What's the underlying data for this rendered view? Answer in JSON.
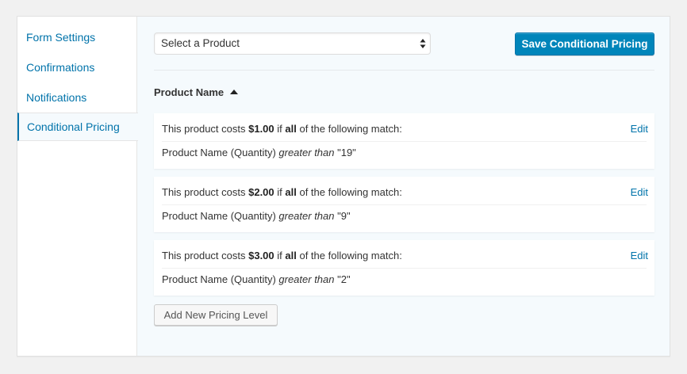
{
  "sidebar": {
    "items": [
      {
        "label": "Form Settings"
      },
      {
        "label": "Confirmations"
      },
      {
        "label": "Notifications"
      },
      {
        "label": "Conditional Pricing",
        "active": true
      }
    ]
  },
  "toolbar": {
    "product_select_value": "Select a Product",
    "save_label": "Save Conditional Pricing"
  },
  "table": {
    "column_header": "Product Name",
    "sort": "ascending"
  },
  "levels": [
    {
      "prefix": "This product costs ",
      "price": "$1.00",
      "mid": " if ",
      "match": "all",
      "suffix": " of the following match:",
      "field": "Product Name (Quantity) ",
      "operator": "greater than",
      "value": " \"19\"",
      "edit_label": "Edit"
    },
    {
      "prefix": "This product costs ",
      "price": "$2.00",
      "mid": " if ",
      "match": "all",
      "suffix": " of the following match:",
      "field": "Product Name (Quantity) ",
      "operator": "greater than",
      "value": " \"9\"",
      "edit_label": "Edit"
    },
    {
      "prefix": "This product costs ",
      "price": "$3.00",
      "mid": " if ",
      "match": "all",
      "suffix": " of the following match:",
      "field": "Product Name (Quantity) ",
      "operator": "greater than",
      "value": " \"2\"",
      "edit_label": "Edit"
    }
  ],
  "add_label": "Add New Pricing Level",
  "colors": {
    "accent": "#0073aa",
    "button_primary": "#0085ba",
    "panel_bg": "#f5fafd"
  },
  "icons": {
    "select_arrows": "up-down-arrows-icon",
    "sort": "sort-ascending-icon"
  }
}
